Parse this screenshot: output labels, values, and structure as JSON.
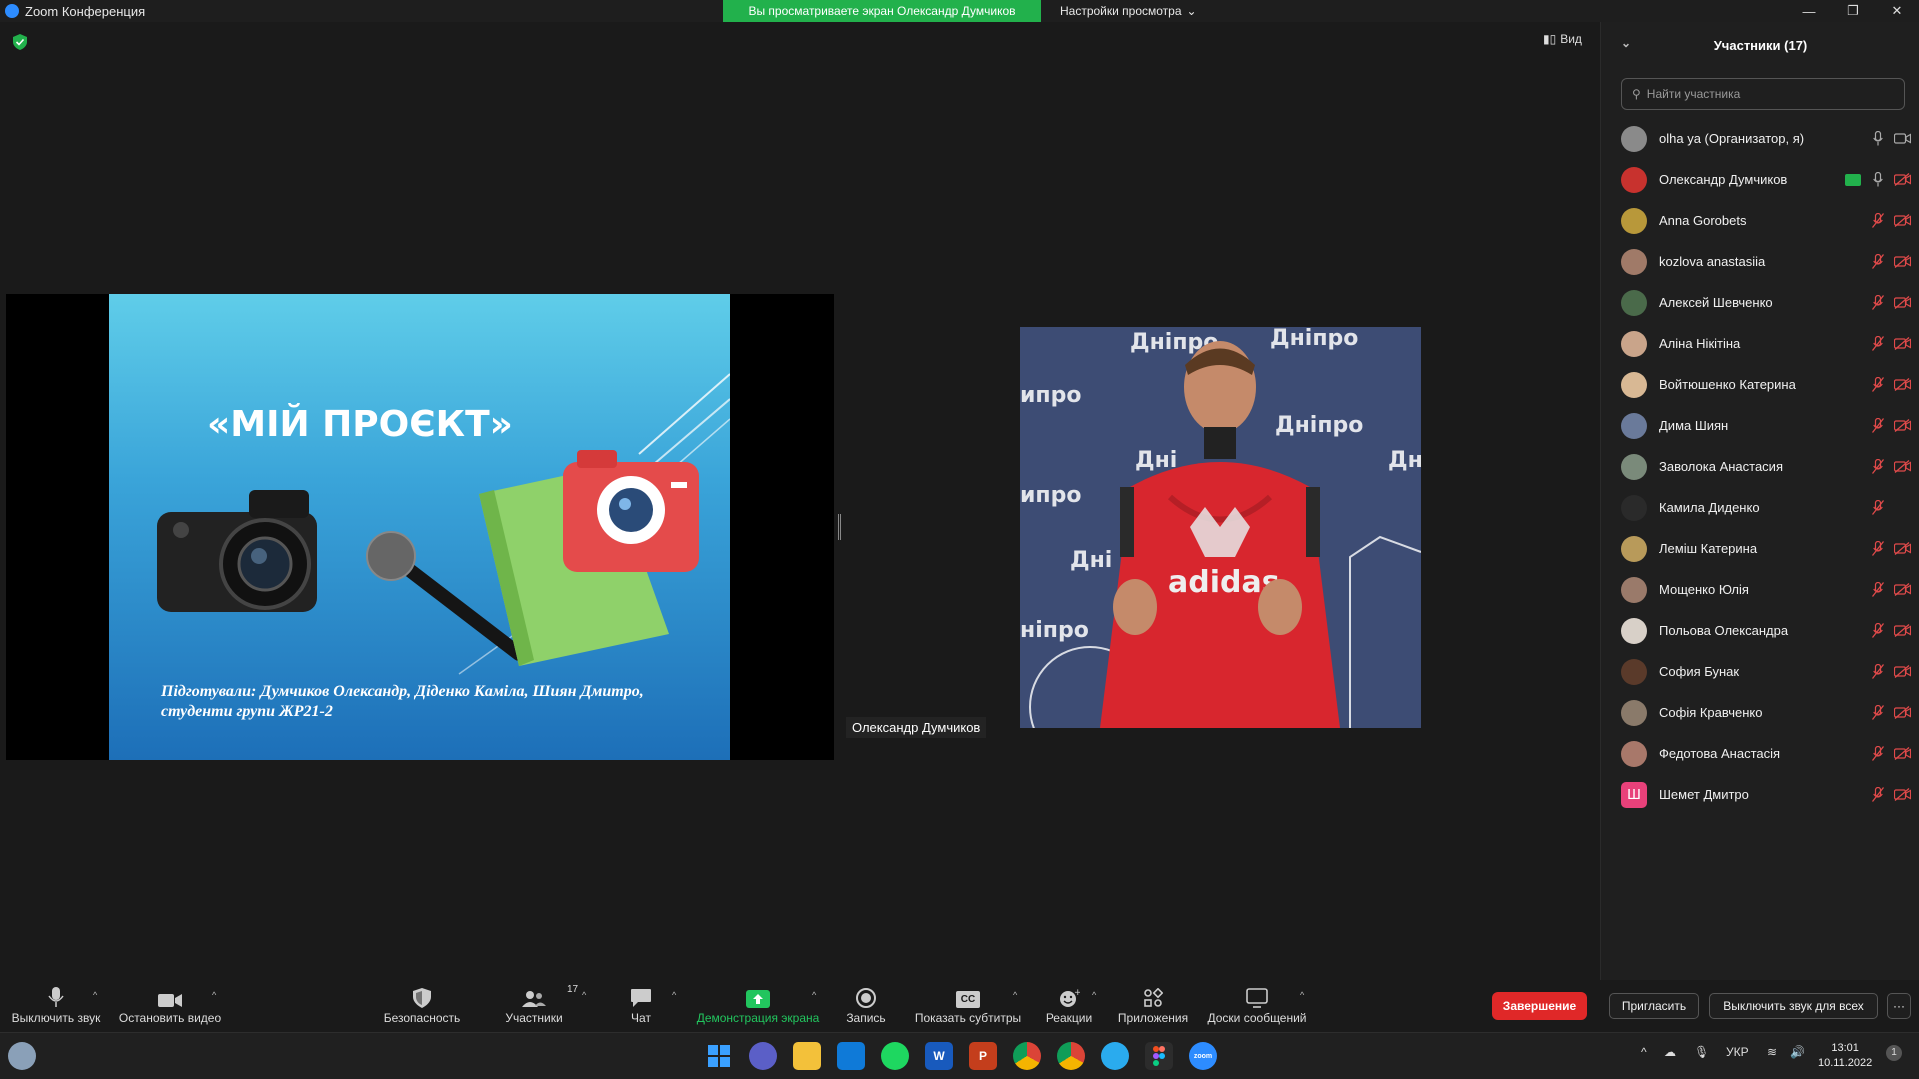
{
  "titlebar": {
    "app_title": "Zoom Конференция",
    "share_banner": "Вы просматриваете экран Олександр Думчиков",
    "view_settings": "Настройки просмотра"
  },
  "stage": {
    "view_label": "Вид",
    "slide": {
      "title": "«МІЙ ПРОЄКТ»",
      "caption": "Підготували: Думчиков Олександр, Діденко Каміла, Шиян Дмитро, студенти групи ЖР21-2"
    },
    "speaker_name": "Олександр Думчиков"
  },
  "panel": {
    "header": "Участники (17)",
    "search_placeholder": "Найти участника",
    "participants": [
      {
        "name": "olha ya (Организатор, я)",
        "color": "#8a8a8a",
        "mic": "on",
        "video": "off-plain"
      },
      {
        "name": "Олександр Думчиков",
        "color": "#c8322e",
        "mic": "on",
        "video": "off",
        "sharing": true
      },
      {
        "name": "Anna Gorobets",
        "color": "#b8983a",
        "mic": "muted",
        "video": "off"
      },
      {
        "name": "kozlova anastasiia",
        "color": "#a07a68",
        "mic": "muted",
        "video": "off"
      },
      {
        "name": "Алексей Шевченко",
        "color": "#4a6a4a",
        "mic": "muted",
        "video": "off"
      },
      {
        "name": "Аліна Нікітіна",
        "color": "#c9a48a",
        "mic": "muted",
        "video": "off"
      },
      {
        "name": "Войтюшенко Катерина",
        "color": "#d8b894",
        "mic": "muted",
        "video": "off"
      },
      {
        "name": "Дима Шиян",
        "color": "#6a7a9a",
        "mic": "muted",
        "video": "off"
      },
      {
        "name": "Заволока Анастасия",
        "color": "#7a8a7a",
        "mic": "muted",
        "video": "off"
      },
      {
        "name": "Камила Диденко",
        "color": "#2a2a2a",
        "mic": "muted",
        "video": "none"
      },
      {
        "name": "Леміш Катерина",
        "color": "#b89a5a",
        "mic": "muted",
        "video": "off"
      },
      {
        "name": "Мощенко Юлія",
        "color": "#9a7a6a",
        "mic": "muted",
        "video": "off"
      },
      {
        "name": "Польова Олександра",
        "color": "#d8d0c8",
        "mic": "muted",
        "video": "off"
      },
      {
        "name": "София Бунак",
        "color": "#5a3a2a",
        "mic": "muted",
        "video": "off"
      },
      {
        "name": "Софія Кравченко",
        "color": "#8a7a6a",
        "mic": "muted",
        "video": "off"
      },
      {
        "name": "Федотова Анастасія",
        "color": "#a8786a",
        "mic": "muted",
        "video": "off"
      },
      {
        "name": "Шемет Дмитро",
        "letter": "Ш",
        "color": "#e8417a",
        "mic": "muted",
        "video": "off"
      }
    ],
    "invite": "Пригласить",
    "mute_all": "Выключить звук для всех",
    "more": "···"
  },
  "toolbar": {
    "mute": "Выключить звук",
    "stop_video": "Остановить видео",
    "security": "Безопасность",
    "participants": "Участники",
    "participants_count": "17",
    "chat": "Чат",
    "share_screen": "Демонстрация экрана",
    "record": "Запись",
    "captions": "Показать субтитры",
    "captions_icon_text": "CC",
    "reactions": "Реакции",
    "apps": "Приложения",
    "whiteboards": "Доски сообщений",
    "end": "Завершение"
  },
  "taskbar": {
    "lang": "УКР",
    "time": "13:01",
    "date": "10.11.2022",
    "notifications": "1",
    "word_letter": "W",
    "ppt_letter": "P",
    "zoom_label": "zoom"
  }
}
